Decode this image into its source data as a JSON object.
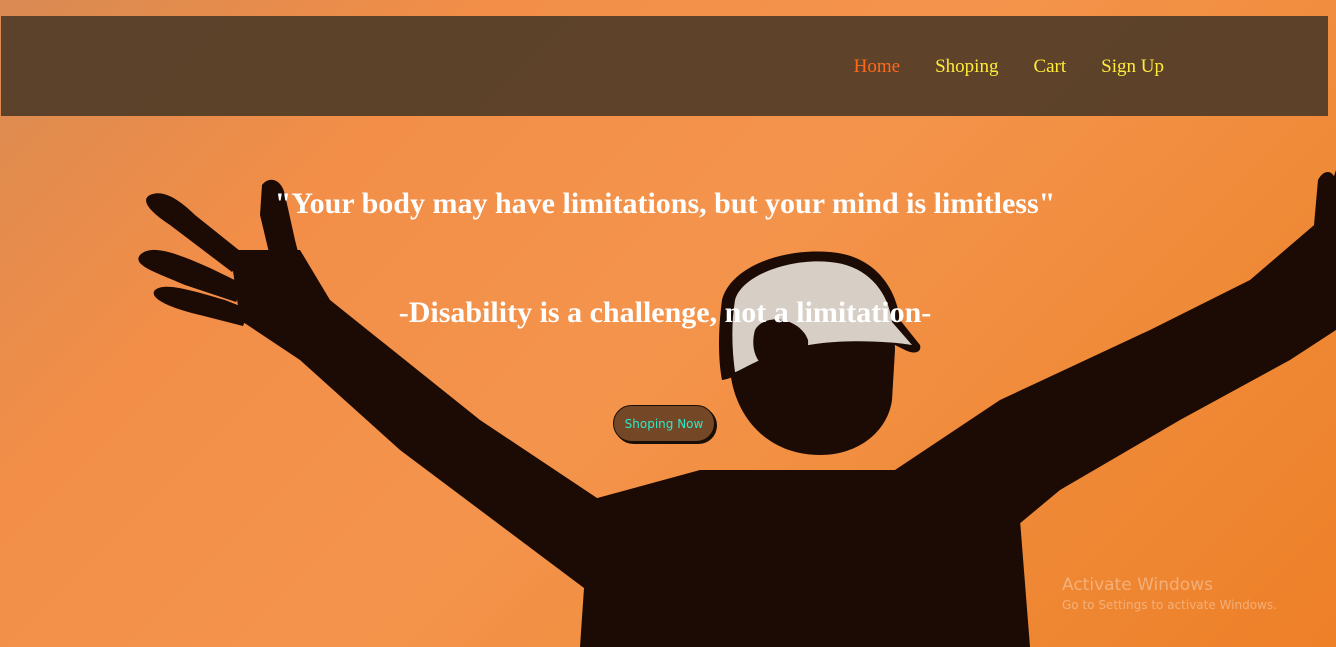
{
  "nav": {
    "items": [
      {
        "label": "Home",
        "active": true
      },
      {
        "label": "Shoping",
        "active": false
      },
      {
        "label": "Cart",
        "active": false
      },
      {
        "label": "Sign Up",
        "active": false
      }
    ]
  },
  "hero": {
    "quote_primary": "\"Your body may have limitations, but your mind is limitless\"",
    "quote_secondary": "-Disability is a challenge, not a limitation-",
    "cta_label": "Shoping Now"
  },
  "watermark": {
    "title": "Activate Windows",
    "subtitle": "Go to Settings to activate Windows."
  },
  "colors": {
    "nav_active": "#ff6a1a",
    "nav_link": "#ffeb3b",
    "cta_bg": "#744826",
    "cta_text": "#2ee9c8",
    "navbar_bg": "#523c28",
    "background": "#f28e48"
  }
}
